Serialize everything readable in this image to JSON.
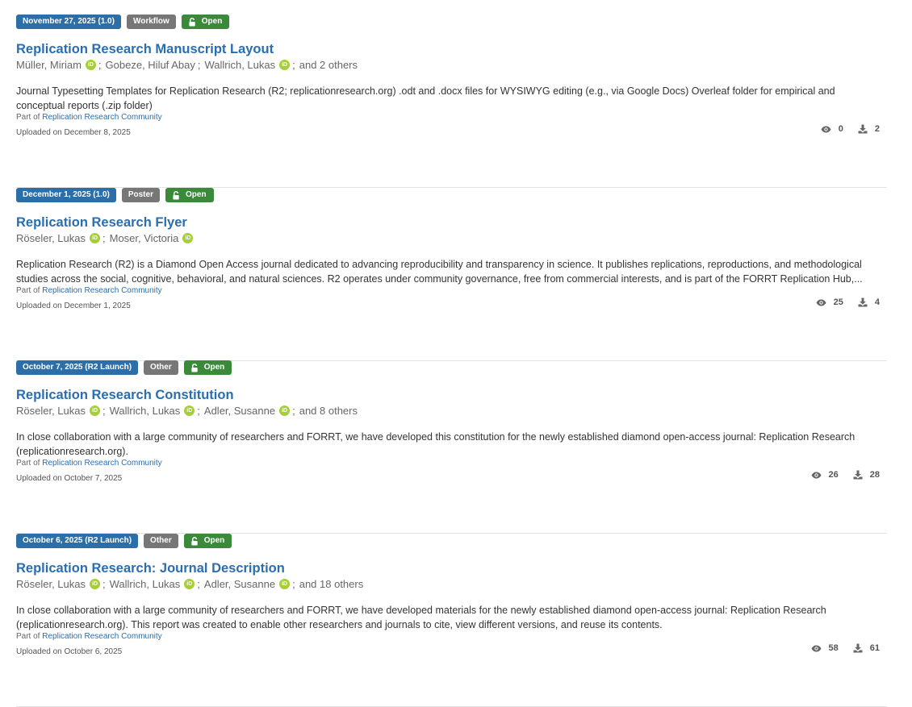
{
  "records": [
    {
      "date_badge": "November 27, 2025 (1.0)",
      "type_badge": "Workflow",
      "access_badge": "Open",
      "title": "Replication Research Manuscript Layout",
      "creators": [
        {
          "name": "Müller, Miriam",
          "orcid": true,
          "sep": ";"
        },
        {
          "name": "Gobeze, Hiluf Abay",
          "orcid": false,
          "sep": ";"
        },
        {
          "name": "Wallrich, Lukas",
          "orcid": true,
          "sep": ";"
        }
      ],
      "others": "and 2 others",
      "description": "Journal Typesetting Templates for Replication Research (R2; replicationresearch.org) .odt and .docx files for WYSIWYG editing (e.g., via Google Docs)  Overleaf folder for empirical and conceptual reports (.zip folder)",
      "part_of_prefix": "Part of",
      "community": "Replication Research Community",
      "uploaded": "Uploaded on December 8, 2025",
      "views": "0",
      "downloads": "2"
    },
    {
      "date_badge": "December 1, 2025 (1.0)",
      "type_badge": "Poster",
      "access_badge": "Open",
      "title": "Replication Research Flyer",
      "creators": [
        {
          "name": "Röseler, Lukas",
          "orcid": true,
          "sep": ";"
        },
        {
          "name": "Moser, Victoria",
          "orcid": true,
          "sep": ""
        }
      ],
      "others": "",
      "description": "Replication Research (R2) is a Diamond Open Access journal dedicated to advancing reproducibility and transparency in science. It publishes replications, reproductions, and methodological studies across the social, cognitive, behavioral, and natural sciences. R2 operates under community governance, free from commercial interests, and is part of the FORRT Replication Hub,...",
      "part_of_prefix": "Part of",
      "community": "Replication Research Community",
      "uploaded": "Uploaded on December 1, 2025",
      "views": "25",
      "downloads": "4"
    },
    {
      "date_badge": "October 7, 2025 (R2 Launch)",
      "type_badge": "Other",
      "access_badge": "Open",
      "title": "Replication Research Constitution",
      "creators": [
        {
          "name": "Röseler, Lukas",
          "orcid": true,
          "sep": ";"
        },
        {
          "name": "Wallrich, Lukas",
          "orcid": true,
          "sep": ";"
        },
        {
          "name": "Adler, Susanne",
          "orcid": true,
          "sep": ";"
        }
      ],
      "others": "and 8 others",
      "description": "In close collaboration with a large community of researchers and FORRT, we have developed this constitution for the newly established diamond open-access journal: Replication Research (replicationresearch.org).",
      "part_of_prefix": "Part of",
      "community": "Replication Research Community",
      "uploaded": "Uploaded on October 7, 2025",
      "views": "26",
      "downloads": "28"
    },
    {
      "date_badge": "October 6, 2025 (R2 Launch)",
      "type_badge": "Other",
      "access_badge": "Open",
      "title": "Replication Research: Journal Description",
      "creators": [
        {
          "name": "Röseler, Lukas",
          "orcid": true,
          "sep": ";"
        },
        {
          "name": "Wallrich, Lukas",
          "orcid": true,
          "sep": ";"
        },
        {
          "name": "Adler, Susanne",
          "orcid": true,
          "sep": ";"
        }
      ],
      "others": "and 18 others",
      "description": "In close collaboration with a large community of researchers and FORRT, we have developed materials for the newly established diamond open-access journal: Replication Research (replicationresearch.org). This report was created to enable other researchers and journals to cite, view different versions, and reuse its contents.",
      "part_of_prefix": "Part of",
      "community": "Replication Research Community",
      "uploaded": "Uploaded on October 6, 2025",
      "views": "58",
      "downloads": "61"
    }
  ],
  "icons": {
    "access": "unlock-icon",
    "creator_id": "orcid-icon",
    "views": "eye-icon",
    "downloads": "download-icon"
  },
  "colors": {
    "date_badge": "#2c6ea8",
    "type_badge": "#777777",
    "access_badge": "#3a8a3a",
    "link": "#2a6eb0",
    "orcid": "#a6ce39"
  }
}
